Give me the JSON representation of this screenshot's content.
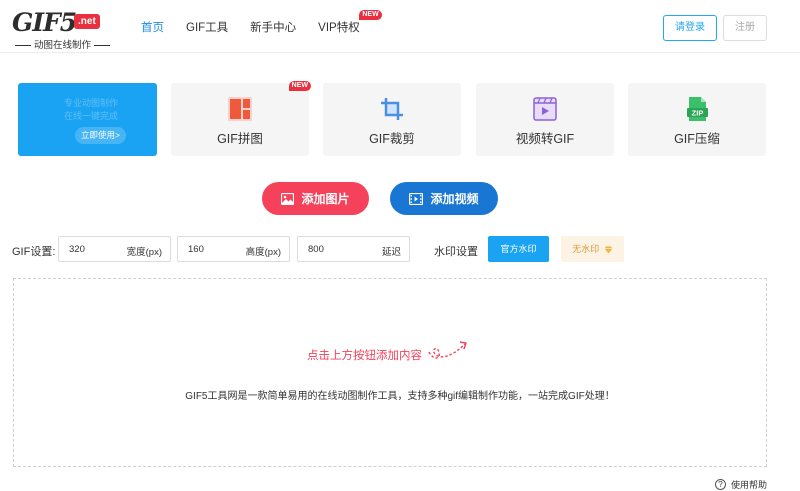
{
  "logo": {
    "text": "GIF5",
    "badge": ".net",
    "subtitle": "动图在线制作"
  },
  "nav": {
    "items": [
      {
        "label": "首页",
        "active": true
      },
      {
        "label": "GIF工具"
      },
      {
        "label": "新手中心"
      },
      {
        "label": "VIP特权",
        "badge": "NEW"
      }
    ]
  },
  "auth": {
    "login_label": "请登录",
    "register_label": "注册"
  },
  "promo": {
    "ghost_line1": "专业动图制作",
    "ghost_line2": "在线一键完成",
    "button_label": "立即使用>"
  },
  "tools": [
    {
      "label": "GIF拼图",
      "icon": "collage-icon",
      "badge": "NEW"
    },
    {
      "label": "GIF裁剪",
      "icon": "crop-icon"
    },
    {
      "label": "视频转GIF",
      "icon": "video-to-gif-icon"
    },
    {
      "label": "GIF压缩",
      "icon": "zip-icon",
      "icon_text": "ZIP"
    }
  ],
  "actions": {
    "add_image": "添加图片",
    "add_video": "添加视频"
  },
  "gif_settings": {
    "label": "GIF设置:",
    "width": {
      "value": "320",
      "unit": "宽度(px)"
    },
    "height": {
      "value": "160",
      "unit": "高度(px)"
    },
    "delay": {
      "value": "800",
      "unit": "延迟"
    }
  },
  "watermark": {
    "label": "水印设置",
    "official": "官方水印",
    "none": "无水印"
  },
  "drop_area": {
    "hint": "点击上方按钮添加内容",
    "description": "GIF5工具网是一款简单易用的在线动图制作工具，支持多种gif编辑制作功能，一站完成GIF处理！"
  },
  "help_label": "使用帮助",
  "colors": {
    "accent_blue": "#1aa3f3",
    "primary_blue": "#1976d2",
    "accent_red": "#f5415a",
    "badge_red": "#e8303f"
  }
}
